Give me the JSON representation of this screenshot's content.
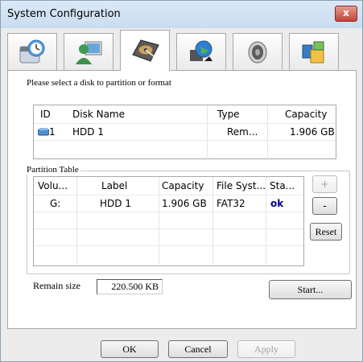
{
  "window": {
    "title": "System Configuration",
    "close": "x"
  },
  "tabs": [
    {
      "icon": "clock-calendar-icon",
      "active": false
    },
    {
      "icon": "user-monitor-icon",
      "active": false
    },
    {
      "icon": "hard-disk-icon",
      "active": true
    },
    {
      "icon": "network-globe-icon",
      "active": false
    },
    {
      "icon": "speaker-icon",
      "active": false
    },
    {
      "icon": "system-tools-icon",
      "active": false
    }
  ],
  "disk": {
    "prompt": "Please select a disk to partition or format",
    "columns": [
      "ID",
      "Disk Name",
      "Type",
      "Capacity"
    ],
    "rows": [
      {
        "id": "1",
        "name": "HDD 1",
        "type": "Rem...",
        "capacity": "1.906 GB"
      }
    ]
  },
  "partition": {
    "group_label": "Partition Table",
    "columns": [
      "Volu...",
      "Label",
      "Capacity",
      "File Syst...",
      "Sta..."
    ],
    "rows": [
      {
        "volume": "G:",
        "label": "HDD 1",
        "capacity": "1.906 GB",
        "fs": "FAT32",
        "status": "ok"
      }
    ],
    "add_button": "+",
    "remove_button": "-",
    "reset_button": "Reset"
  },
  "remain": {
    "label": "Remain size",
    "value": "220.500 KB"
  },
  "start_button": "Start...",
  "footer": {
    "ok": "OK",
    "cancel": "Cancel",
    "apply": "Apply"
  },
  "colors": {
    "status_ok": "#00008b",
    "accent": "#3c7fb1"
  }
}
